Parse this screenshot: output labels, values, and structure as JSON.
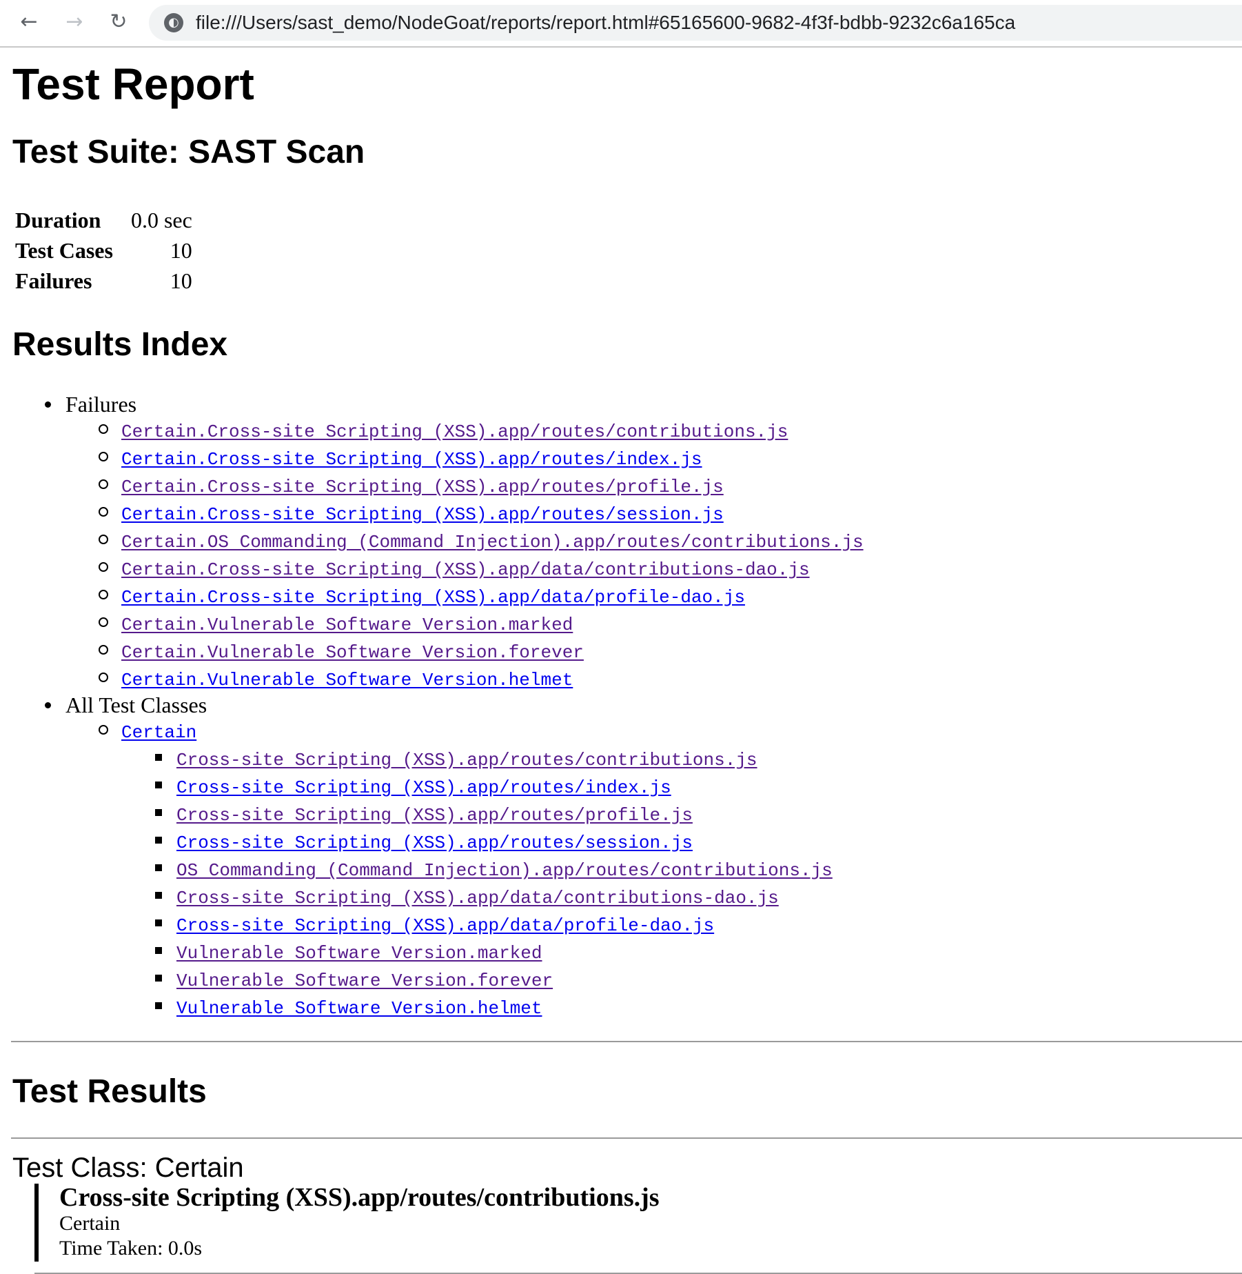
{
  "browser": {
    "url": "file:///Users/sast_demo/NodeGoat/reports/report.html#65165600-9682-4f3f-bdbb-9232c6a165ca",
    "back_icon": "←",
    "forward_icon": "→",
    "reload_icon": "↻",
    "site_info_icon": "globe"
  },
  "report": {
    "title": "Test Report",
    "suite_title": "Test Suite: SAST Scan",
    "summary": [
      {
        "label": "Duration",
        "value": "0.0 sec"
      },
      {
        "label": "Test Cases",
        "value": "10"
      },
      {
        "label": "Failures",
        "value": "10"
      }
    ],
    "index_title": "Results Index",
    "failures_label": "Failures",
    "failures": [
      {
        "label": "Certain.Cross-site Scripting (XSS).app/routes/contributions.js",
        "visited": true
      },
      {
        "label": "Certain.Cross-site Scripting (XSS).app/routes/index.js",
        "visited": false
      },
      {
        "label": "Certain.Cross-site Scripting (XSS).app/routes/profile.js",
        "visited": true
      },
      {
        "label": "Certain.Cross-site Scripting (XSS).app/routes/session.js",
        "visited": false
      },
      {
        "label": "Certain.OS Commanding (Command Injection).app/routes/contributions.js",
        "visited": true
      },
      {
        "label": "Certain.Cross-site Scripting (XSS).app/data/contributions-dao.js",
        "visited": true
      },
      {
        "label": "Certain.Cross-site Scripting (XSS).app/data/profile-dao.js",
        "visited": false
      },
      {
        "label": "Certain.Vulnerable Software Version.marked",
        "visited": true
      },
      {
        "label": "Certain.Vulnerable Software Version.forever",
        "visited": true
      },
      {
        "label": "Certain.Vulnerable Software Version.helmet",
        "visited": false
      }
    ],
    "all_classes_label": "All Test Classes",
    "class_name": "Certain",
    "class_tests": [
      {
        "label": "Cross-site Scripting (XSS).app/routes/contributions.js",
        "visited": true
      },
      {
        "label": "Cross-site Scripting (XSS).app/routes/index.js",
        "visited": false
      },
      {
        "label": "Cross-site Scripting (XSS).app/routes/profile.js",
        "visited": true
      },
      {
        "label": "Cross-site Scripting (XSS).app/routes/session.js",
        "visited": false
      },
      {
        "label": "OS Commanding (Command Injection).app/routes/contributions.js",
        "visited": true
      },
      {
        "label": "Cross-site Scripting (XSS).app/data/contributions-dao.js",
        "visited": true
      },
      {
        "label": "Cross-site Scripting (XSS).app/data/profile-dao.js",
        "visited": false
      },
      {
        "label": "Vulnerable Software Version.marked",
        "visited": true
      },
      {
        "label": "Vulnerable Software Version.forever",
        "visited": true
      },
      {
        "label": "Vulnerable Software Version.helmet",
        "visited": false
      }
    ],
    "results_title": "Test Results",
    "test_class_heading": "Test Class: Certain",
    "first_case": {
      "name": "Cross-site Scripting (XSS).app/routes/contributions.js",
      "class": "Certain",
      "time": "Time Taken: 0.0s"
    },
    "link_colors": {
      "unvisited": "#0000ee",
      "visited": "#551a8b"
    }
  }
}
